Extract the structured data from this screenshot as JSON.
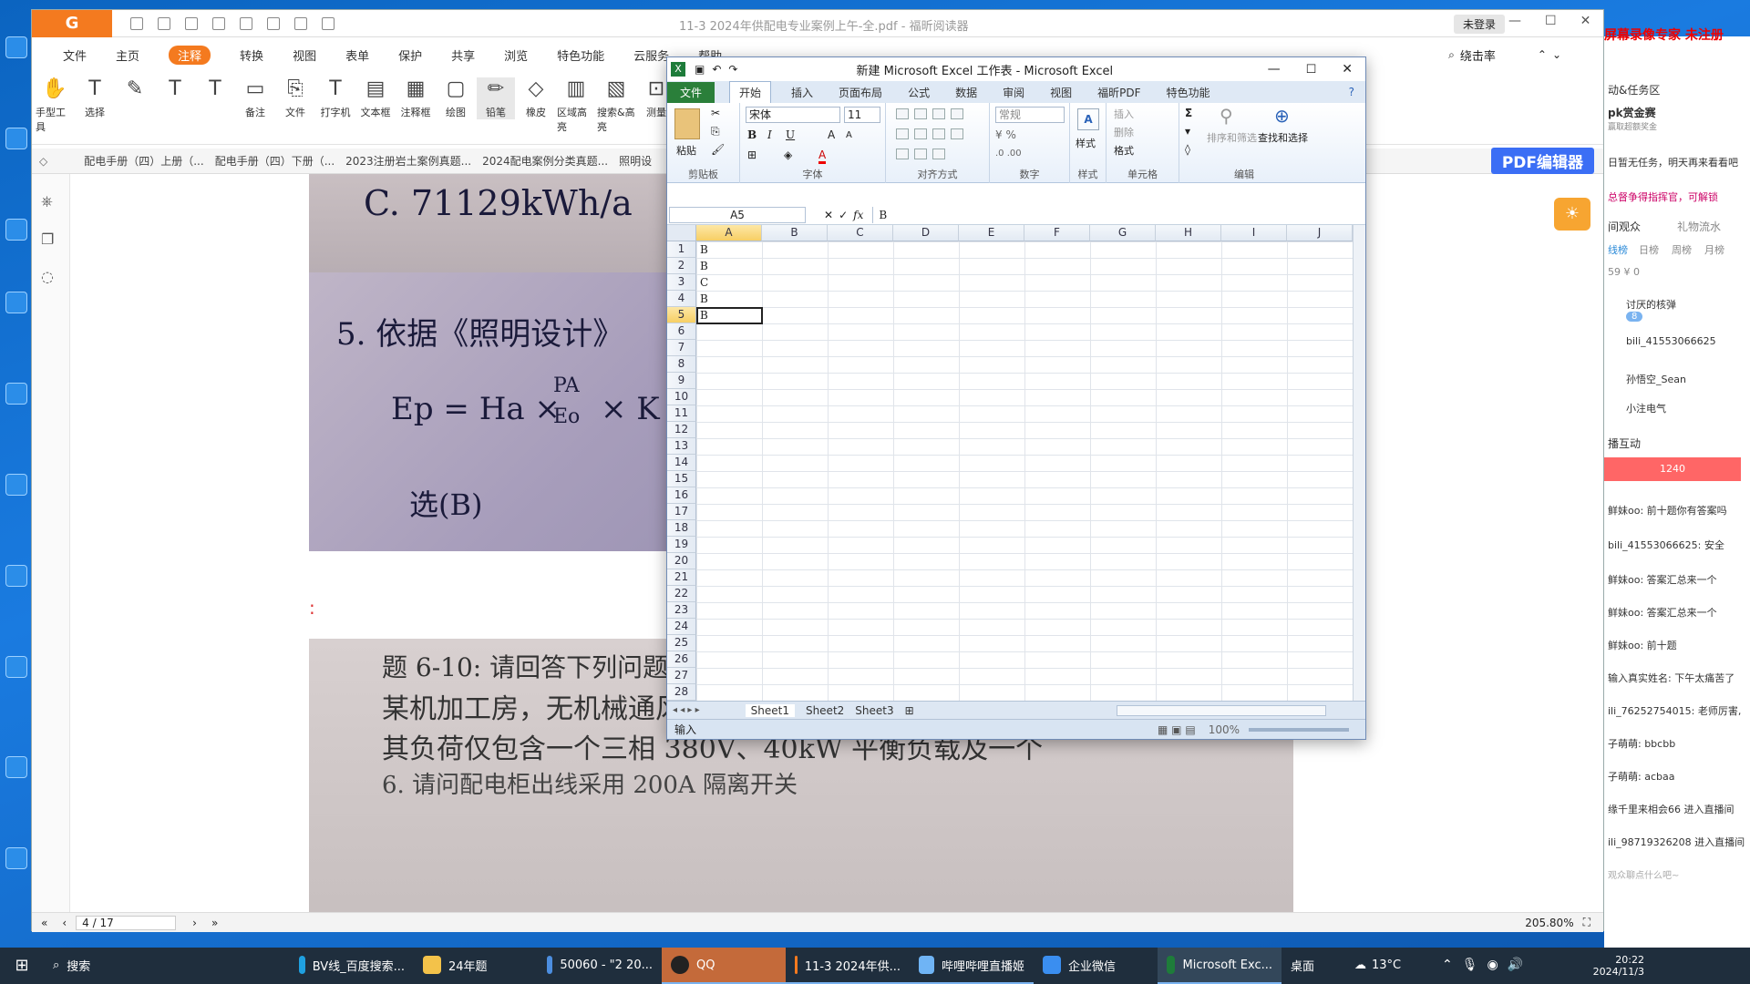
{
  "pdf": {
    "title": "11-3 2024年供配电专业案例上午-全.pdf - 福昕阅读器",
    "login": "未登录",
    "menu": [
      "文件",
      "主页",
      "注释",
      "转换",
      "视图",
      "表单",
      "保护",
      "共享",
      "浏览",
      "特色功能",
      "云服务",
      "帮助"
    ],
    "menu_active": "注释",
    "search_value": "绕击率",
    "ribbon": [
      "手型工具",
      "选择",
      "",
      "",
      "",
      "",
      "备注",
      "文件",
      "打字机",
      "文本框",
      "注释框",
      "绘图",
      "铅笔",
      "橡皮",
      "区域高亮",
      "搜索&高亮",
      "测量"
    ],
    "tabs": [
      "配电手册（四）上册（...",
      "配电手册（四）下册（...",
      "2023注册岩土案例真题...",
      "2024配电案例分类真题...",
      "照明设"
    ],
    "edit_button": "PDF编辑器",
    "page_input": "4 / 17",
    "zoom": "205.80%",
    "content": {
      "photo1_text": "C. 71129kWh/a",
      "photo2_line1": "5. 依据《照明设计》",
      "photo2_formula_lhs": "Ep = Ha ×",
      "photo2_formula_frac_num": "PA",
      "photo2_formula_frac_den": "Eo",
      "photo2_formula_rhs": "× K =",
      "photo2_answer": "选(B)",
      "colon": ":",
      "q6_number": "6.",
      "photo3_line1": "题 6-10: 请回答下列问题",
      "photo3_line2": "某机加工房，无机械通风，内有一 220/380V 配电柜，",
      "photo3_line3": "其负荷仅包含一个三相 380V、40kW 平衡负载及一个",
      "photo3_line4": "6. 请问配电柜出线采用 200A 隔离开关"
    }
  },
  "excel": {
    "title": "新建 Microsoft Excel 工作表 - Microsoft Excel",
    "tabs": [
      "文件",
      "开始",
      "插入",
      "页面布局",
      "公式",
      "数据",
      "审阅",
      "视图",
      "福昕PDF",
      "特色功能"
    ],
    "active_tab": "开始",
    "font_name": "宋体",
    "font_size": "11",
    "number_format": "常规",
    "groups": [
      "剪贴板",
      "字体",
      "对齐方式",
      "数字",
      "样式",
      "单元格",
      "编辑"
    ],
    "cells_group": [
      "插入",
      "删除",
      "格式"
    ],
    "edit_group": [
      "排序和筛选",
      "查找和选择"
    ],
    "paste": "粘贴",
    "style": "样式",
    "name_box": "A5",
    "formula": "B",
    "columns": [
      "A",
      "B",
      "C",
      "D",
      "E",
      "F",
      "G",
      "H",
      "I",
      "J"
    ],
    "rows": [
      "1",
      "2",
      "3",
      "4",
      "5",
      "6",
      "7",
      "8",
      "9",
      "10",
      "11",
      "12",
      "13",
      "14",
      "15",
      "16",
      "17",
      "18",
      "19",
      "20",
      "21",
      "22",
      "23",
      "24",
      "25",
      "26",
      "27",
      "28"
    ],
    "cell_values": [
      "B",
      "B",
      "C",
      "B",
      "B"
    ],
    "sheets": [
      "Sheet1",
      "Sheet2",
      "Sheet3"
    ],
    "status": "输入",
    "zoom": "100%"
  },
  "live": {
    "top_text": "屏幕录像专家 未注册",
    "tasks": "动&任务区",
    "pk": "pk赏金赛",
    "pk_sub": "赢取超额奖金",
    "notice1": "日暂无任务，明天再来看看吧",
    "notice2": "总督争得指挥官，可解锁",
    "tab_viewers": "间观众",
    "tab_gifts": "礼物流水",
    "subtabs": [
      "线榜",
      "日榜",
      "周榜",
      "月榜"
    ],
    "stats": "59 ¥ 0",
    "users": [
      "讨厌的核弹",
      "bili_41553066625",
      "孙悟空_Sean",
      "小注电气"
    ],
    "user_badge": "8",
    "interact": "播互动",
    "popular": "1240",
    "chat": [
      "鲜妹oo: 前十题你有答案吗",
      "bili_41553066625: 安全",
      "鲜妹oo: 答案汇总来一个",
      "鲜妹oo: 答案汇总来一个",
      "鲜妹oo: 前十题",
      "输入真实姓名: 下午太痛苦了",
      "ili_76252754015: 老师厉害,",
      "子萌萌: bbcbb",
      "子萌萌: acbaa",
      "缘千里来相会66 进入直播间",
      "ili_98719326208 进入直播间",
      "观众聊点什么吧~"
    ]
  },
  "taskbar": {
    "search": "搜索",
    "items": [
      "BV线_百度搜索...",
      "24年题",
      "50060 - \"2 20...",
      "QQ",
      "11-3 2024年供...",
      "哔哩哔哩直播姬",
      "企业微信",
      "Microsoft Exc..."
    ],
    "desktop": "桌面",
    "weather": "13°C",
    "time": "20:22",
    "date": "2024/11/3"
  },
  "desktop_icons": [
    "腾讯",
    "企业",
    "此",
    "回",
    "Mic",
    "附件",
    "QQ"
  ]
}
